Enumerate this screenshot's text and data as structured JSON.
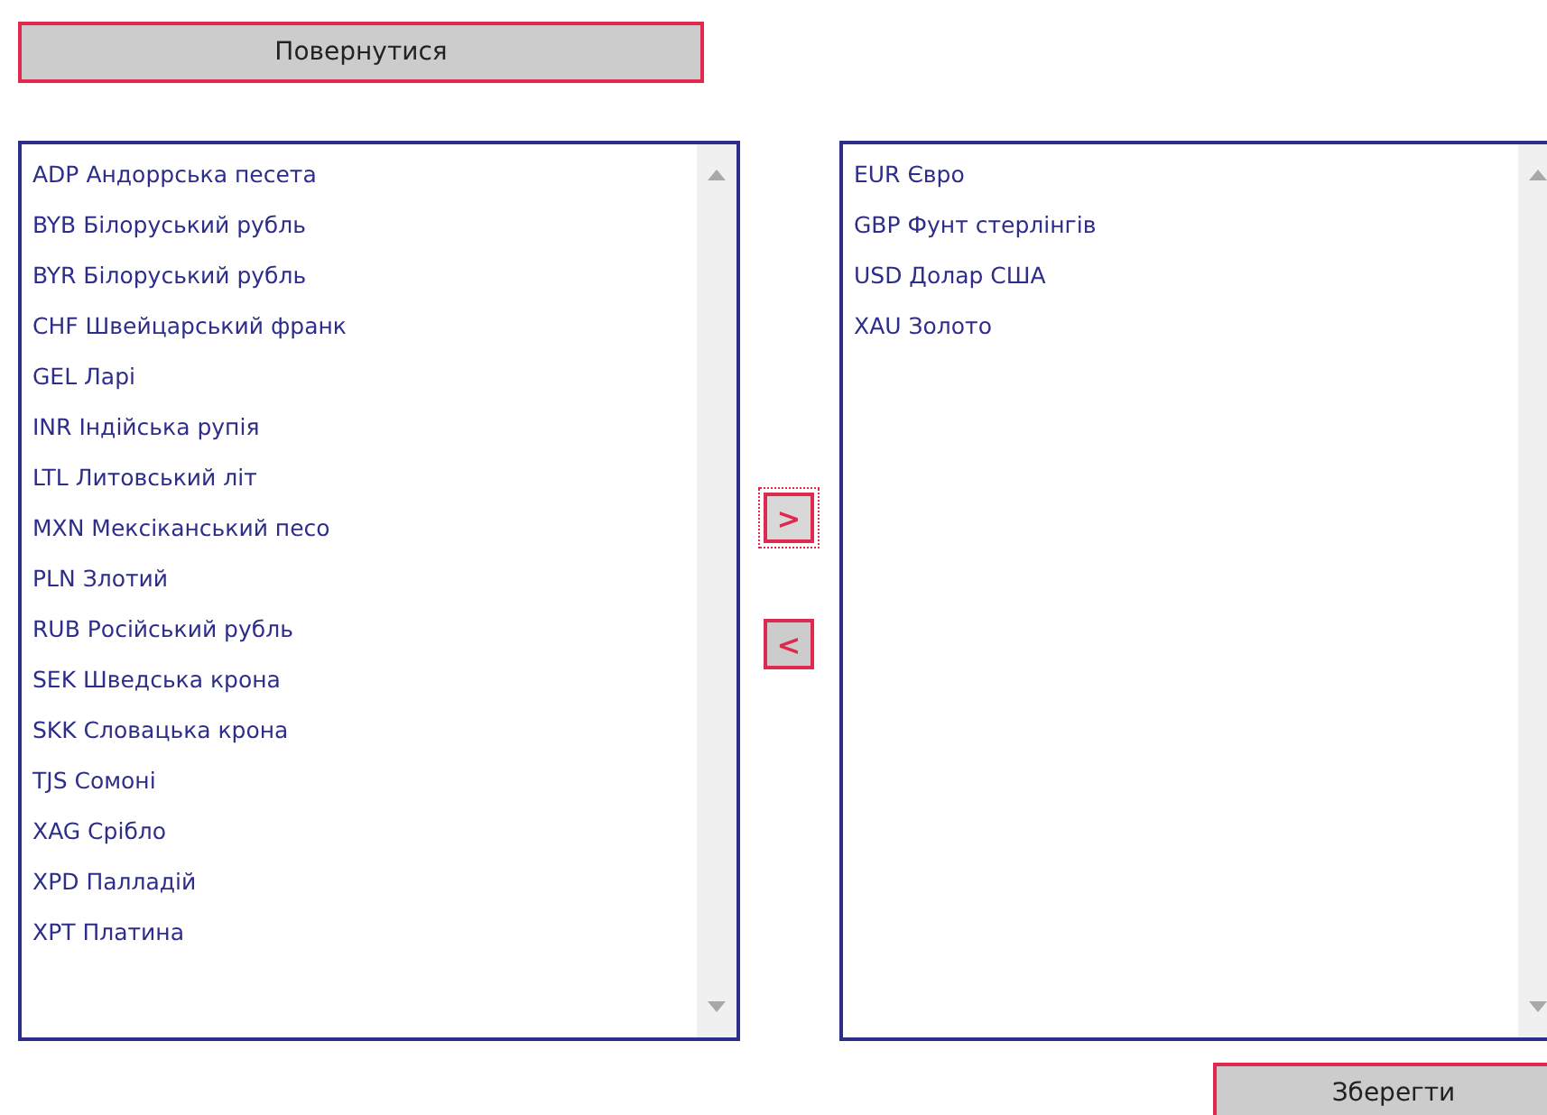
{
  "back_button": {
    "label": "Повернутися"
  },
  "available_list": {
    "items": [
      {
        "label": "ADP Андоррська песета"
      },
      {
        "label": "BYB Білоруський рубль"
      },
      {
        "label": "BYR Білоруський рубль"
      },
      {
        "label": "CHF Швейцарський франк"
      },
      {
        "label": "GEL Ларі"
      },
      {
        "label": "INR Індійська рупія"
      },
      {
        "label": "LTL Литовський літ"
      },
      {
        "label": "MXN Мексіканський песо"
      },
      {
        "label": "PLN Злотий"
      },
      {
        "label": "RUB Російський рубль"
      },
      {
        "label": "SEK Шведська крона"
      },
      {
        "label": "SKK Словацька крона"
      },
      {
        "label": "TJS Сомоні"
      },
      {
        "label": "XAG Срібло"
      },
      {
        "label": "XPD Палладій"
      },
      {
        "label": "XPT Платина"
      }
    ]
  },
  "move_buttons": [
    {
      "label": ">",
      "focused": true
    },
    {
      "label": "<",
      "focused": false
    }
  ],
  "selected_list": {
    "items": [
      {
        "label": "EUR Євро"
      },
      {
        "label": "GBP Фунт стерлінгів"
      },
      {
        "label": "USD Долар США"
      },
      {
        "label": "XAU Золото"
      }
    ]
  },
  "save_button": {
    "label": "Зберегти"
  }
}
